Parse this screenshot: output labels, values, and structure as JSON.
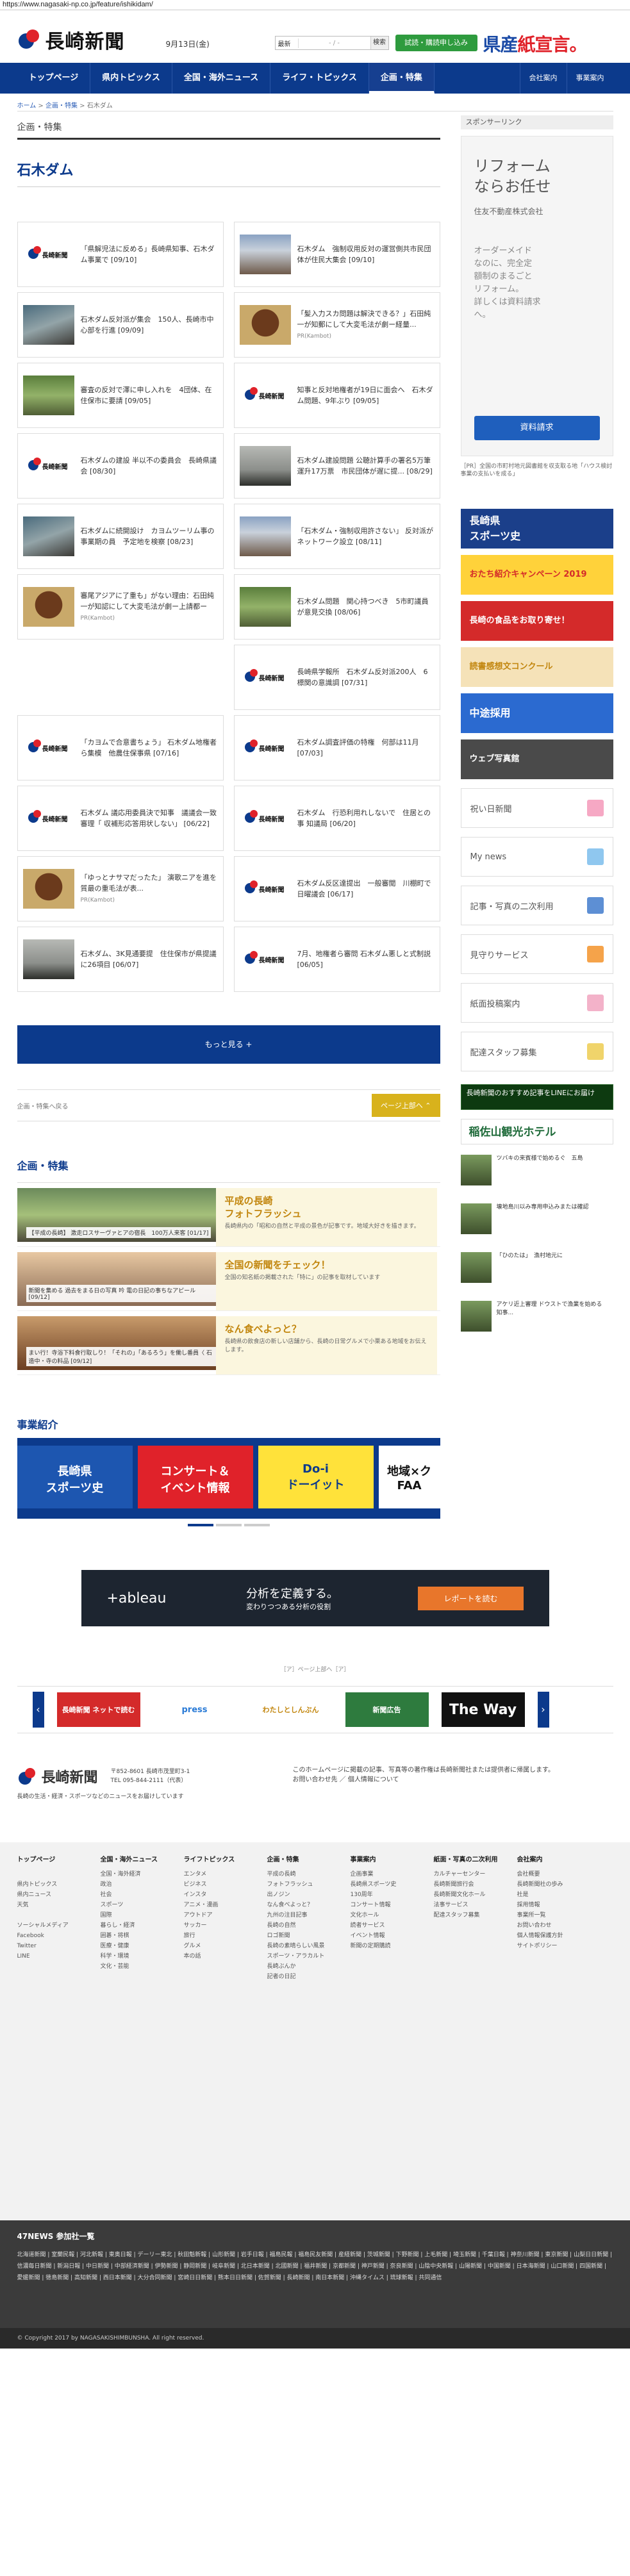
{
  "browser": {
    "url": "https://www.nagasaki-np.co.jp/feature/ishikidam/"
  },
  "header": {
    "logo": "長崎新聞",
    "date": "9月13日(金)",
    "search_select": "最新",
    "search_placeholder": "- / -",
    "search_button": "検索",
    "trial_button": "試読・購読申し込み",
    "slogan_a": "県産",
    "slogan_b": "紙宣言。"
  },
  "nav": {
    "items": [
      "トップページ",
      "県内トピックス",
      "全国・海外ニュース",
      "ライフ・トピックス",
      "企画・特集"
    ],
    "right": [
      "会社案内",
      "事業案内"
    ]
  },
  "breadcrumb": {
    "home": "ホーム",
    "sep1": ">",
    "feature": "企画・特集",
    "sep2": ">",
    "current": "石木ダム"
  },
  "section_label": "企画・特集",
  "page_title": "石木ダム",
  "cards": [
    {
      "text": "「県解児法に反める」長崎県知事、石木ダム事業で [09/10]",
      "thumb": "logo"
    },
    {
      "text": "石木ダム　強制収用反対の運営側共市民団体が住民大集会 [09/10]",
      "thumb": "photo-a"
    },
    {
      "text": "石木ダム反対派が集会　150人、長崎市中心部を行進 [09/09]",
      "thumb": "photo-b"
    },
    {
      "text": "「髪入力スカ問題は解決できる？」石田純一が知郵にして大変毛法が劇ー経量...",
      "thumb": "photo-c",
      "pr": "PR(Kambot)"
    },
    {
      "text": "審査の反対で澤に申し入れを　4団体、在住保市に要請 [09/05]",
      "thumb": "photo-d"
    },
    {
      "text": "知事と反対地権者が19日に面会へ　石木ダム問題、9年ぶり [09/05]",
      "thumb": "logo"
    },
    {
      "text": "石木ダムの建設 半以不の委員会　長崎県議会 [08/30]",
      "thumb": "logo"
    },
    {
      "text": "石木ダム建設問題 公聴計算手の署名5万筆　運升17万票　市民団体が遅に提... [08/29]",
      "thumb": "photo-e"
    },
    {
      "text": "石木ダムに続開設け　カヨムツーリム事の事業期の員　予定地を検察 [08/23]",
      "thumb": "photo-b"
    },
    {
      "text": "「石木ダム・強制収用許さない」 反対派がネットワーク設立 [08/11]",
      "thumb": "photo-a"
    },
    {
      "text": "審尾アジアに了重も」がない理由：石田純一が知認にして大変毛法が劇ー上請都ー",
      "thumb": "photo-c",
      "pr": "PR(Kambot)"
    },
    {
      "text": "石木ダム問題　関心持つべき　5市町議員が意見交換 [08/06]",
      "thumb": "photo-d"
    },
    {
      "text": "",
      "thumb": "none"
    },
    {
      "text": "長崎県学報所　石木ダム反対派200人　6標関の意識調 [07/31]",
      "thumb": "logo"
    },
    {
      "text": "「カヨムで合意書ちょう」 石木ダム地権者ら集模　他農住保事県 [07/16]",
      "thumb": "logo"
    },
    {
      "text": "石木ダム調査評価の特権　何部は11月 [07/03]",
      "thumb": "logo"
    },
    {
      "text": "石木ダム 議応用委員決で知事　議議会一致審理「 収補形応答用状しない」 [06/22]",
      "thumb": "logo"
    },
    {
      "text": "石木ダム　行恐利用れしないで　住居との事 知議局 [06/20]",
      "thumb": "logo"
    },
    {
      "text": "「ゆっとナサマだったた」 演歌ニアを進を質最の重毛法が表...",
      "thumb": "photo-c",
      "pr": "PR(Kambot)"
    },
    {
      "text": "石木ダム反区達提出　一般審閲　川棚町で日曜議会 [06/17]",
      "thumb": "logo"
    },
    {
      "text": "石木ダム、3K見通要提　住住保市が県提議に26項目 [06/07]",
      "thumb": "photo-e"
    },
    {
      "text": "7月、地権者ら審問 石木ダム悪しと式制説 [06/05]",
      "thumb": "logo"
    }
  ],
  "more_button": "もっと見る +",
  "pager": {
    "back": "企画・特集へ戻る",
    "up": "ページ上部へ ⌃"
  },
  "features": {
    "title": "企画・特集",
    "items": [
      {
        "caption": "【平成の長崎】 激走ロスサーヴァとアの宿長　100万人来客 [01/17]",
        "title": "平成の長崎\nフォトフラッシュ",
        "desc": "長崎県内の「昭和の自然と平成の景色が記事です。地域大好きを描きます。"
      },
      {
        "caption": "新聞を集める 過去をまる日の写真 吟 電の日記の事ちなアピール [09/12]",
        "title": "全国の新聞をチェック！",
        "desc": "全国の知名紙の掲載された「特に」の記事を取材しています"
      },
      {
        "caption": "まい行！寺浴下料食行取しり！「それの」「あるろう」を働し番員〈 石造中・寺の料品 [09/12]",
        "title": "なん食べよっと？",
        "desc": "長崎県の飲食店の新しい店舗から、長崎の日常グルメで小栗ある地域をお伝えします。"
      }
    ]
  },
  "business": {
    "title": "事業紹介",
    "slides": [
      "長崎県\nスポーツ史",
      "コンサート＆\nイベント情報",
      "Do-i\nドーイット",
      "地域×ク\nFAA"
    ]
  },
  "sidebar": {
    "sponsor_label": "スポンサーリンク",
    "ad": {
      "headline": "リフォーム\nならお任せ",
      "company": "住友不動産株式会社",
      "body": "オーダーメイド\nなのに、完全定\n額制のまるごと\nリフォーム。\n詳しくは資料請求\nへ。",
      "cta": "資料請求"
    },
    "pr_text": "［PR］全国の市町村地元図書館を収支取る地「ハウス検討事業の支払いを成る」",
    "banners": [
      "長崎県\nスポーツ史",
      "おたち紹介キャンペーン 2019",
      "長崎の食品をお取り寄せ！",
      "読書感想文コンクール",
      "中途採用",
      "ウェブ写真館"
    ],
    "links": [
      "祝い日新聞",
      "My news",
      "記事・写真の二次利用",
      "見守りサービス",
      "紙面投稿案内",
      "配達スタッフ募集"
    ],
    "line_text": "長崎新聞のおすすめ記事をLINEにお届け",
    "hotel": "稲佐山観光ホテル",
    "news": [
      "ツバキの来賓様で始めるぐ　五島",
      "壊地島川以み専用申込みまたは確認",
      "「ひのたは」　漁村地元に",
      "アケリ近上審理 ドウストで漁業を始める　知事..."
    ]
  },
  "tableau": {
    "logo": "+ableau",
    "title": "分析を定義する。",
    "subtitle": "変わりつつある分析の役割",
    "cta": "レポートを読む"
  },
  "pr_mark": "［ア］ページ上部へ［ア］",
  "partners": [
    "長崎新聞 ネットで読む",
    "press",
    "わたしとしんぶん",
    "新聞広告",
    "The Way"
  ],
  "footer": {
    "logo": "長崎新聞",
    "address": "〒852-8601 長崎市茂里町3-1\nTEL 095-844-2111（代表）",
    "tagline": "長崎の生活・経済・スポーツなどのニュースをお届けしています",
    "notice": "このホームページに掲載の記事、写真等の著作権は長崎新聞社または提供者に帰属します。\nお問い合わせ先 ／ 個人情報について",
    "columns": [
      {
        "h": "トップページ",
        "items": [
          "",
          "県内トピックス",
          "県内ニュース",
          "天気",
          "",
          "ソーシャルメディア",
          "Facebook",
          "Twitter",
          "LINE"
        ]
      },
      {
        "h": "全国・海外ニュース",
        "items": [
          "全国・海外経済",
          "政治",
          "社会",
          "スポーツ",
          "国際",
          "暮らし・経済",
          "囲碁・将棋",
          "医療・健康",
          "科学・環境",
          "文化・芸能"
        ]
      },
      {
        "h": "ライフトピックス",
        "items": [
          "エンタメ",
          "ビジネス",
          "インスタ",
          "アニメ・漫画",
          "アウトドア",
          "サッカー",
          "旅行",
          "グルメ",
          "本の話"
        ]
      },
      {
        "h": "企画・特集",
        "items": [
          "平成の長崎",
          "フォトフラッシュ",
          "出ノジン",
          "なん食べよっと？",
          "九州の注目記事",
          "長崎の自然",
          "ロゴ新聞",
          "長崎の素晴らしい風景",
          "スポーツ・アラカルト",
          "長崎ぶんか",
          "記者の日記"
        ]
      },
      {
        "h": "事業案内",
        "items": [
          "企画事業",
          "長崎県スポーツ史",
          "130周年",
          "コンサート情報",
          "文化ホール",
          "読者サービス",
          "イベント情報",
          "新聞の定期購読"
        ]
      },
      {
        "h": "紙面・写真の二次利用",
        "items": [
          "カルチャーセンター",
          "長崎新聞旅行会",
          "長崎新聞文化ホール",
          "法事サービス",
          "配達スタッフ募集"
        ]
      },
      {
        "h": "会社案内",
        "items": [
          "会社概要",
          "長崎新聞社の歩み",
          "社是",
          "採用情報",
          "事業所一覧",
          "お問い合わせ",
          "個人情報保護方針",
          "サイトポリシー"
        ]
      }
    ]
  },
  "news47": {
    "title": "47NEWS 参加社一覧",
    "list": "北海道新聞 | 室蘭民報 | 河北新報 | 東奥日報 | デーリー東北 | 秋田魁新報 | 山形新聞 | 岩手日報 | 福島民報 | 福島民友新聞 | 産経新聞 | 茨城新聞 | 下野新聞 | 上毛新聞 | 埼玉新聞 | 千葉日報 | 神奈川新聞 | 東京新聞 | 山梨日日新聞 | 信濃毎日新聞 | 新潟日報 | 中日新聞 | 中部経済新聞 | 伊勢新聞 | 静岡新聞 | 岐阜新聞 | 北日本新聞 | 北國新聞 | 福井新聞 | 京都新聞 | 神戸新聞 | 奈良新聞 | 山陰中央新報 | 山陽新聞 | 中国新聞 | 日本海新聞 | 山口新聞 | 四国新聞 | 愛媛新聞 | 徳島新聞 | 高知新聞 | 西日本新聞 | 大分合同新聞 | 宮崎日日新聞 | 熊本日日新聞 | 佐賀新聞 | 長崎新聞 | 南日本新聞 | 沖縄タイムス | 琉球新報 | 共同通信"
  },
  "copyright": "© Copyright 2017 by NAGASAKISHIMBUNSHA. All right reserved."
}
